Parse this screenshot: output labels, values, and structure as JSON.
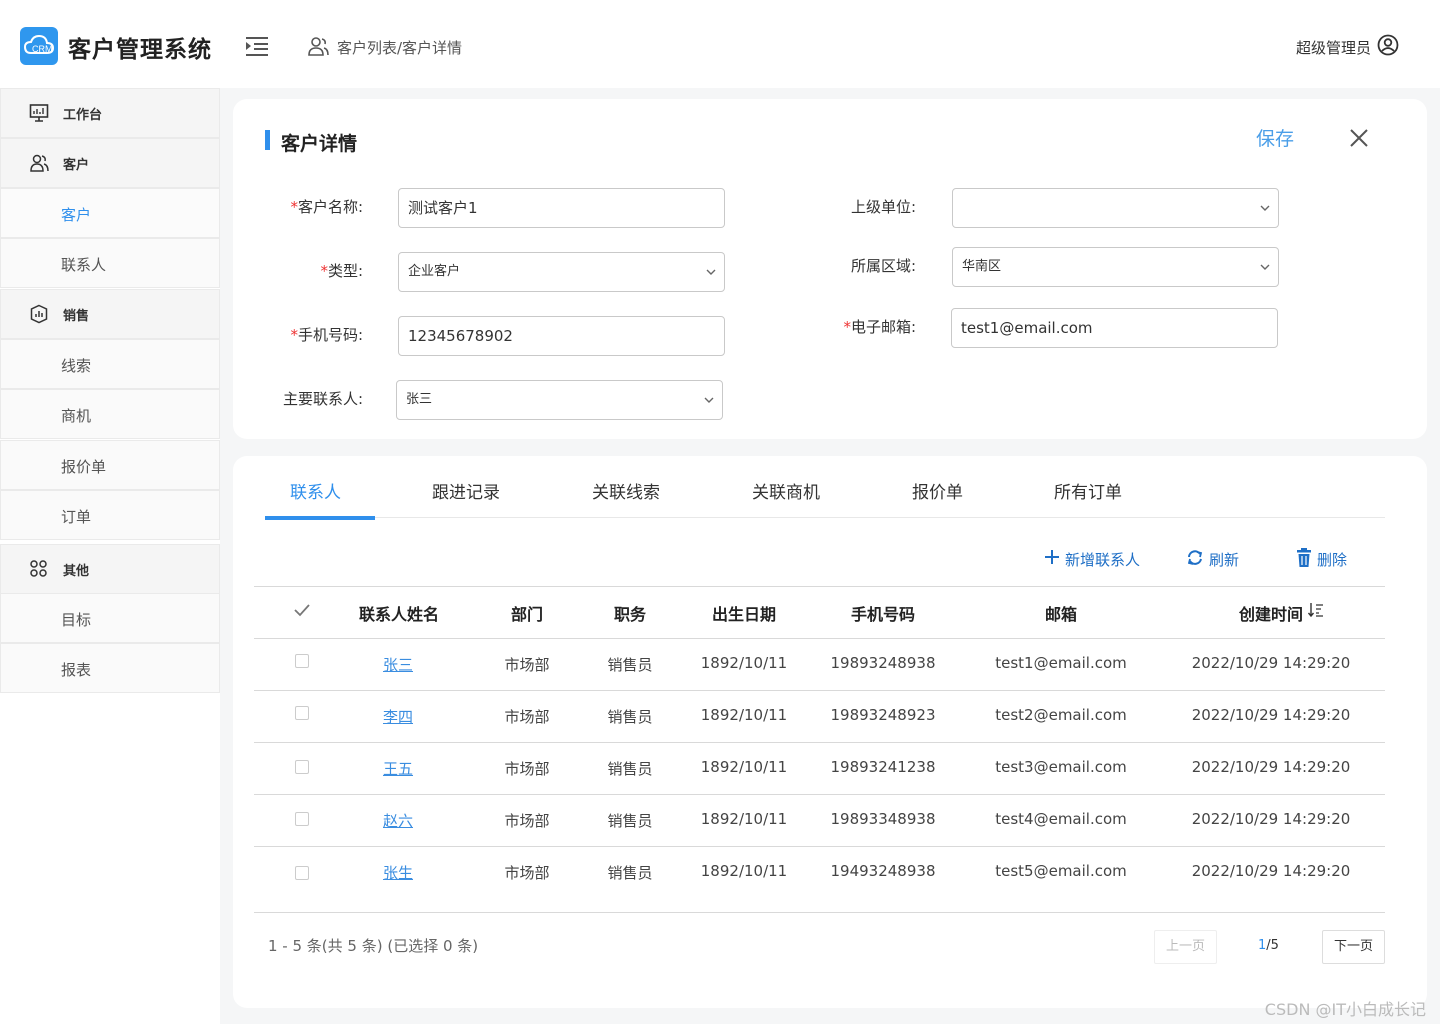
{
  "header": {
    "logo_text": "CRM",
    "app_title": "客户管理系统",
    "breadcrumb": "客户列表/客户详情",
    "user_name": "超级管理员"
  },
  "sidebar": {
    "items": [
      {
        "label": "工作台",
        "kind": "group",
        "icon": "monitor-icon"
      },
      {
        "label": "客户",
        "kind": "group",
        "icon": "users-icon"
      },
      {
        "label": "客户",
        "kind": "child",
        "active": true
      },
      {
        "label": "联系人",
        "kind": "child"
      },
      {
        "label": "销售",
        "kind": "group",
        "icon": "shield-icon"
      },
      {
        "label": "线索",
        "kind": "child"
      },
      {
        "label": "商机",
        "kind": "child"
      },
      {
        "label": "报价单",
        "kind": "child"
      },
      {
        "label": "订单",
        "kind": "child"
      },
      {
        "label": "其他",
        "kind": "group",
        "icon": "grid-icon"
      },
      {
        "label": "目标",
        "kind": "child"
      },
      {
        "label": "报表",
        "kind": "child"
      }
    ]
  },
  "detail": {
    "title": "客户详情",
    "save_label": "保存",
    "required_mark": "*",
    "fields": {
      "customer_name": {
        "label": "客户名称:",
        "value": "测试客户1"
      },
      "type": {
        "label": "类型:",
        "value": "企业客户"
      },
      "phone": {
        "label": "手机号码:",
        "value": "12345678902"
      },
      "main_contact": {
        "label": "主要联系人:",
        "value": "张三"
      },
      "parent_unit": {
        "label": "上级单位:",
        "value": ""
      },
      "region": {
        "label": "所属区域:",
        "value": "华南区"
      },
      "email": {
        "label": "电子邮箱:",
        "value": "test1@email.com"
      }
    }
  },
  "tabs": [
    "联系人",
    "跟进记录",
    "关联线索",
    "关联商机",
    "报价单",
    "所有订单"
  ],
  "actions": {
    "add": "新增联系人",
    "refresh": "刷新",
    "delete": "删除"
  },
  "table": {
    "headers": [
      "联系人姓名",
      "部门",
      "职务",
      "出生日期",
      "手机号码",
      "邮箱",
      "创建时间"
    ],
    "rows": [
      [
        "张三",
        "市场部",
        "销售员",
        "1892/10/11",
        "19893248938",
        "test1@email.com",
        "2022/10/29 14:29:20"
      ],
      [
        "李四",
        "市场部",
        "销售员",
        "1892/10/11",
        "19893248923",
        "test2@email.com",
        "2022/10/29 14:29:20"
      ],
      [
        "王五",
        "市场部",
        "销售员",
        "1892/10/11",
        "19893241238",
        "test3@email.com",
        "2022/10/29 14:29:20"
      ],
      [
        "赵六",
        "市场部",
        "销售员",
        "1892/10/11",
        "19893348938",
        "test4@email.com",
        "2022/10/29 14:29:20"
      ],
      [
        "张生",
        "市场部",
        "销售员",
        "1892/10/11",
        "19493248938",
        "test5@email.com",
        "2022/10/29 14:29:20"
      ]
    ]
  },
  "pagination": {
    "info": "1 - 5 条(共 5 条) (已选择 0 条)",
    "prev": "上一页",
    "current": "1",
    "total": "/5",
    "next": "下一页"
  },
  "footer_note": "CSDN @IT小白成长记",
  "colors": {
    "accent": "#2f8fec",
    "link": "#3a8de0",
    "required": "#e33333"
  }
}
